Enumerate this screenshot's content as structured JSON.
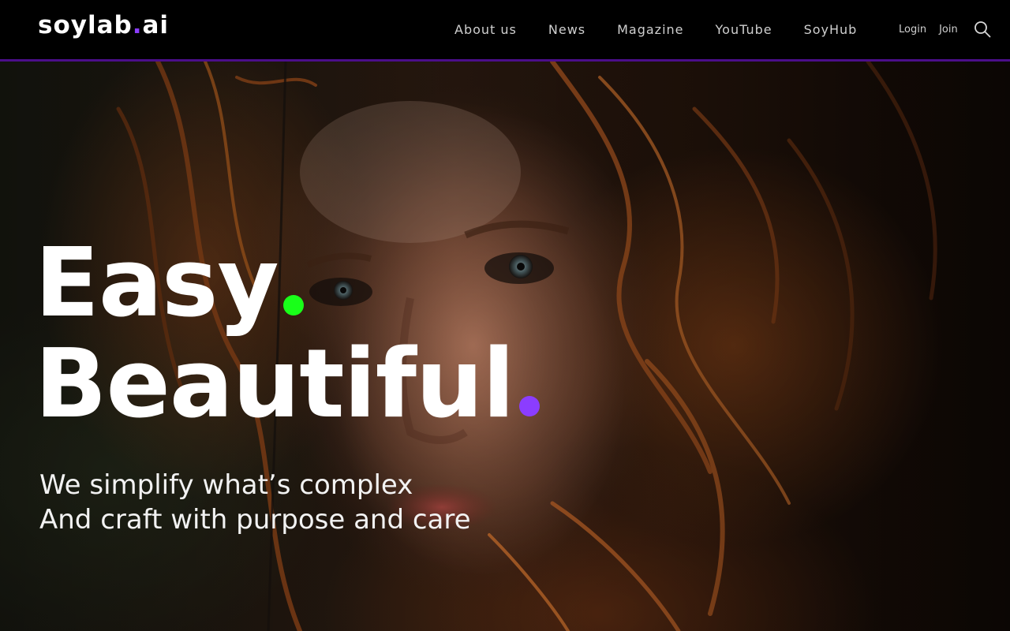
{
  "header": {
    "logo": {
      "text": "soylab",
      "dot": ".",
      "suffix": "ai"
    },
    "nav": [
      "About us",
      "News",
      "Magazine",
      "YouTube",
      "SoyHub"
    ],
    "auth": {
      "login": "Login",
      "join": "Join"
    },
    "search_icon": "search-icon"
  },
  "hero": {
    "headline_line1": "Easy",
    "headline_line2": "Beautiful",
    "tagline_line1": "We simplify what’s complex",
    "tagline_line2": "And craft with purpose and care"
  },
  "colors": {
    "header_bg": "#000000",
    "header_border": "#4b0e8a",
    "accent_green": "#19ff19",
    "accent_purple": "#8b3dff",
    "nav_text": "#cfcfcf",
    "headline_text": "#ffffff"
  }
}
